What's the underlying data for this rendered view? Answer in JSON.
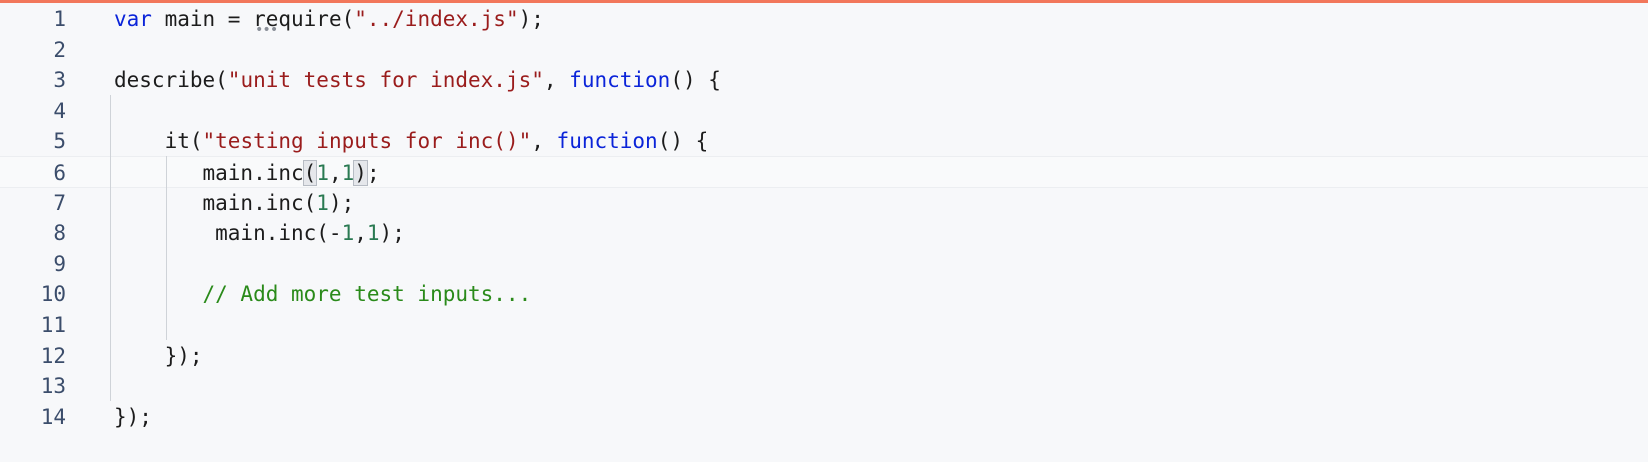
{
  "editor": {
    "lines": [
      {
        "number": "1",
        "tokens": [
          {
            "t": "var",
            "c": "kw"
          },
          {
            "t": " main = require(",
            "c": ""
          },
          {
            "t": "\"../index.js\"",
            "c": "str"
          },
          {
            "t": ");",
            "c": ""
          }
        ]
      },
      {
        "number": "2",
        "tokens": []
      },
      {
        "number": "3",
        "tokens": [
          {
            "t": "describe(",
            "c": ""
          },
          {
            "t": "\"unit tests for index.js\"",
            "c": "str"
          },
          {
            "t": ", ",
            "c": ""
          },
          {
            "t": "function",
            "c": "kw"
          },
          {
            "t": "() {",
            "c": ""
          }
        ]
      },
      {
        "number": "4",
        "tokens": []
      },
      {
        "number": "5",
        "tokens": [
          {
            "t": "    it(",
            "c": ""
          },
          {
            "t": "\"testing inputs for inc()\"",
            "c": "str"
          },
          {
            "t": ", ",
            "c": ""
          },
          {
            "t": "function",
            "c": "kw"
          },
          {
            "t": "() {",
            "c": ""
          }
        ]
      },
      {
        "number": "6",
        "tokens": [
          {
            "t": "       main.inc",
            "c": ""
          },
          {
            "t": "(",
            "c": "br"
          },
          {
            "t": "1",
            "c": "num"
          },
          {
            "t": ",",
            "c": ""
          },
          {
            "t": "1",
            "c": "num"
          },
          {
            "t": ")",
            "c": "br"
          },
          {
            "t": ";",
            "c": ""
          }
        ]
      },
      {
        "number": "7",
        "tokens": [
          {
            "t": "       main.inc(",
            "c": ""
          },
          {
            "t": "1",
            "c": "num"
          },
          {
            "t": ");",
            "c": ""
          }
        ]
      },
      {
        "number": "8",
        "tokens": [
          {
            "t": "        main.inc(-",
            "c": ""
          },
          {
            "t": "1",
            "c": "num"
          },
          {
            "t": ",",
            "c": ""
          },
          {
            "t": "1",
            "c": "num"
          },
          {
            "t": ");",
            "c": ""
          }
        ]
      },
      {
        "number": "9",
        "tokens": []
      },
      {
        "number": "10",
        "tokens": [
          {
            "t": "       // Add more test inputs...",
            "c": "cmt"
          }
        ]
      },
      {
        "number": "11",
        "tokens": []
      },
      {
        "number": "12",
        "tokens": [
          {
            "t": "    });",
            "c": ""
          }
        ]
      },
      {
        "number": "13",
        "tokens": []
      },
      {
        "number": "14",
        "tokens": [
          {
            "t": "});",
            "c": ""
          }
        ]
      }
    ],
    "current_line": "6",
    "colors": {
      "keyword": "#0b24d9",
      "string": "#9a1c1c",
      "number": "#2a7a52",
      "comment": "#2a8a1a",
      "line_number": "#3b4d6b",
      "accent_top_border": "#f2775b"
    }
  }
}
